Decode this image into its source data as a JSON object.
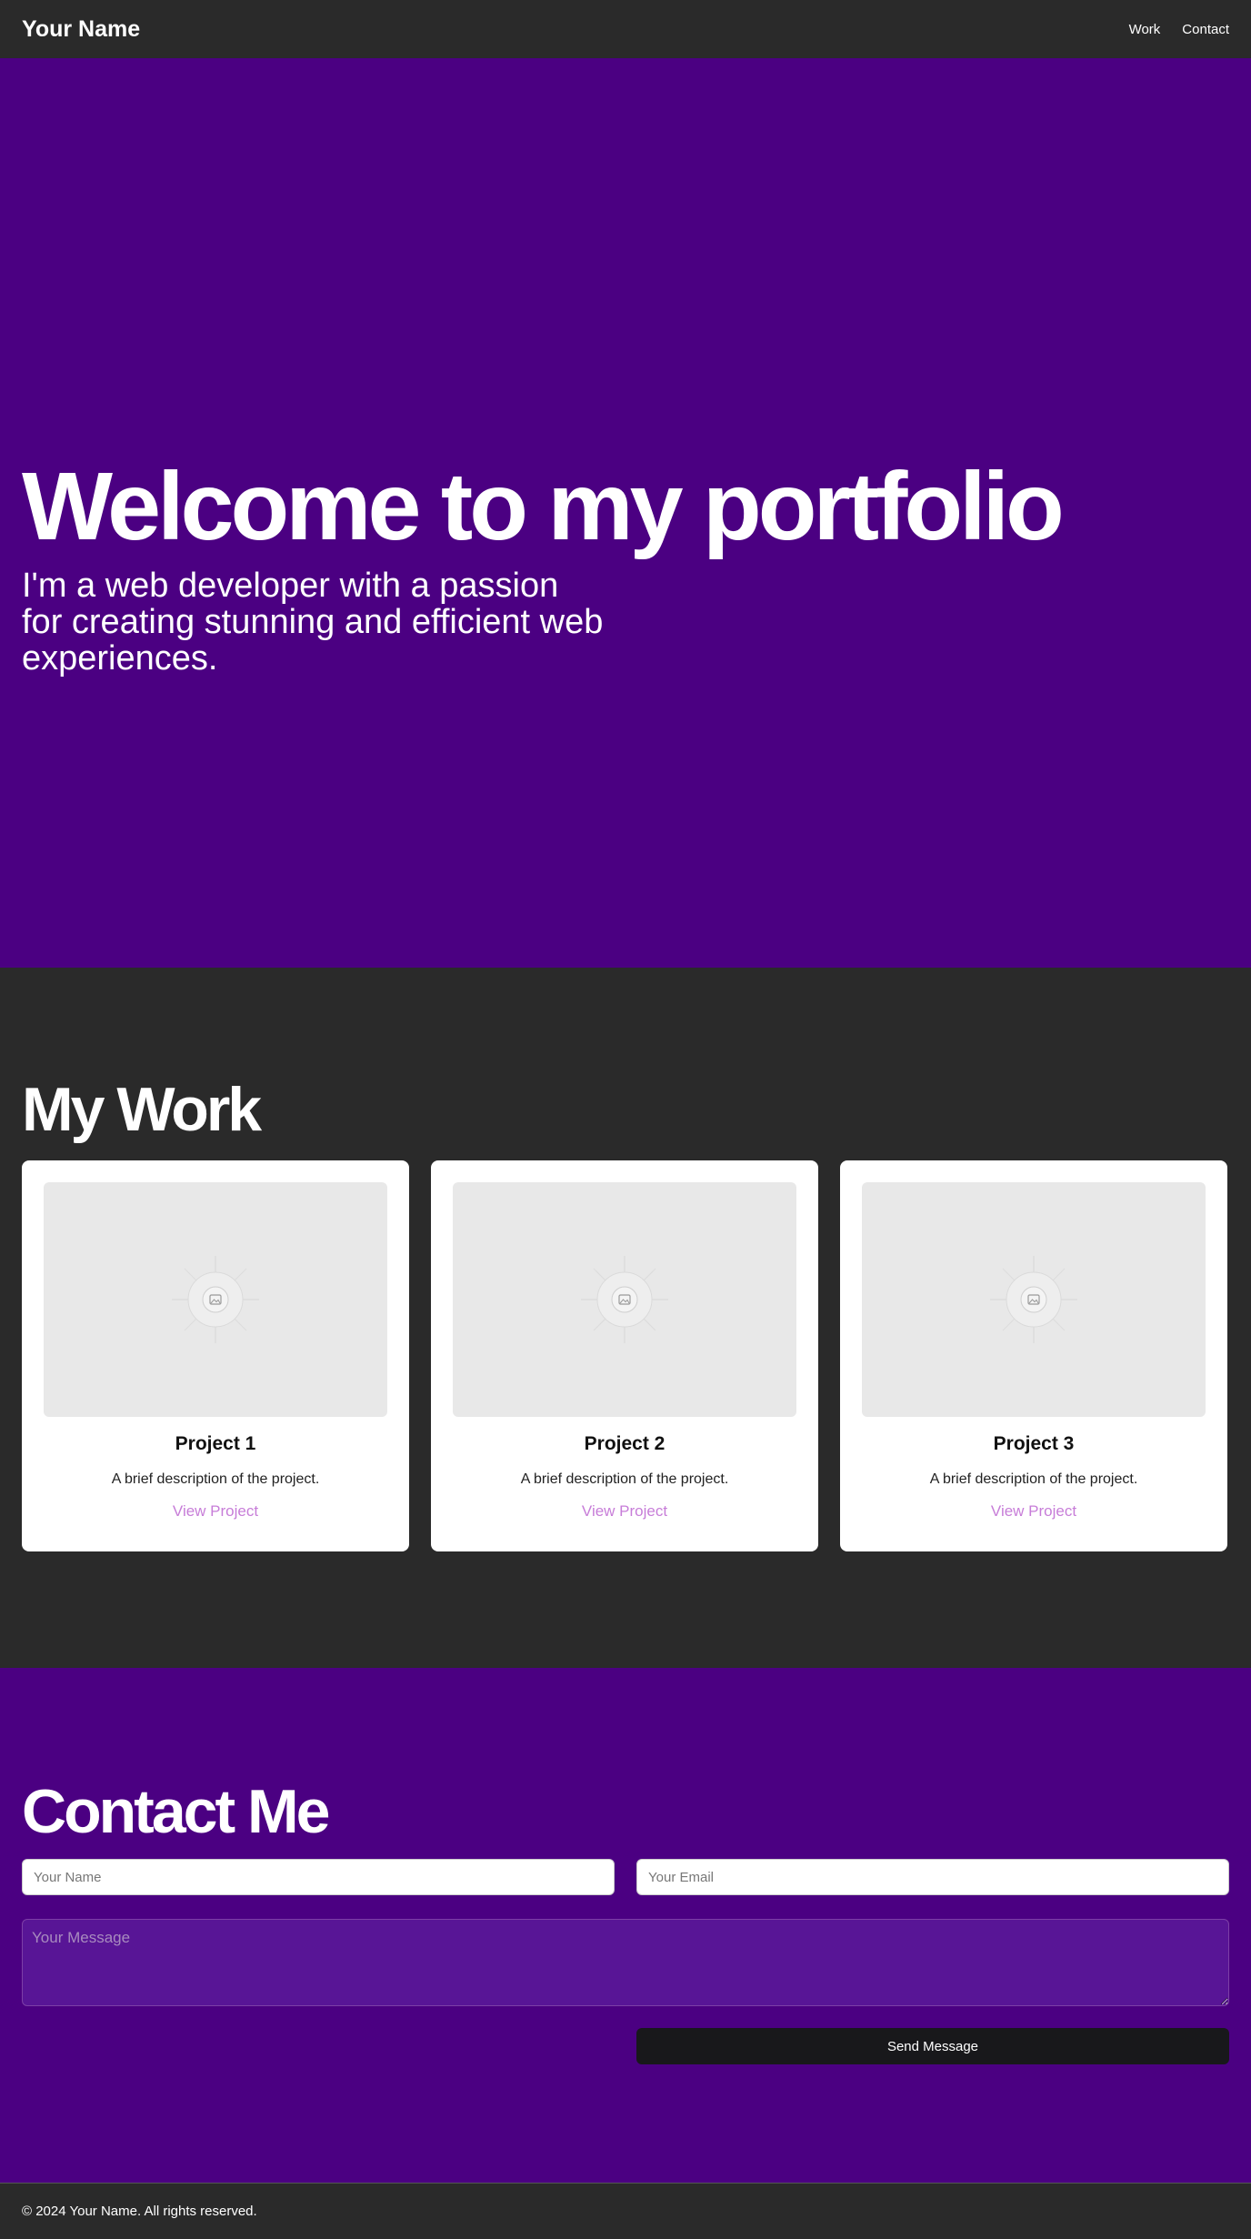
{
  "header": {
    "brand": "Your Name",
    "nav": [
      {
        "label": "Work"
      },
      {
        "label": "Contact"
      }
    ]
  },
  "hero": {
    "title": "Welcome to my portfolio",
    "subtitle": "I'm a web developer with a passion for creating stunning and efficient web experiences."
  },
  "work": {
    "title": "My Work",
    "projects": [
      {
        "title": "Project 1",
        "description": "A brief description of the project.",
        "link_label": "View Project",
        "image_icon": "image-placeholder-icon"
      },
      {
        "title": "Project 2",
        "description": "A brief description of the project.",
        "link_label": "View Project",
        "image_icon": "image-placeholder-icon"
      },
      {
        "title": "Project 3",
        "description": "A brief description of the project.",
        "link_label": "View Project",
        "image_icon": "image-placeholder-icon"
      }
    ]
  },
  "contact": {
    "title": "Contact Me",
    "name_placeholder": "Your Name",
    "email_placeholder": "Your Email",
    "message_placeholder": "Your Message",
    "submit_label": "Send Message"
  },
  "footer": {
    "text": "© 2024 Your Name. All rights reserved."
  },
  "colors": {
    "accent": "#4b0082",
    "dark": "#2a2a2a",
    "link": "#c77dd8",
    "button": "#18181b"
  }
}
